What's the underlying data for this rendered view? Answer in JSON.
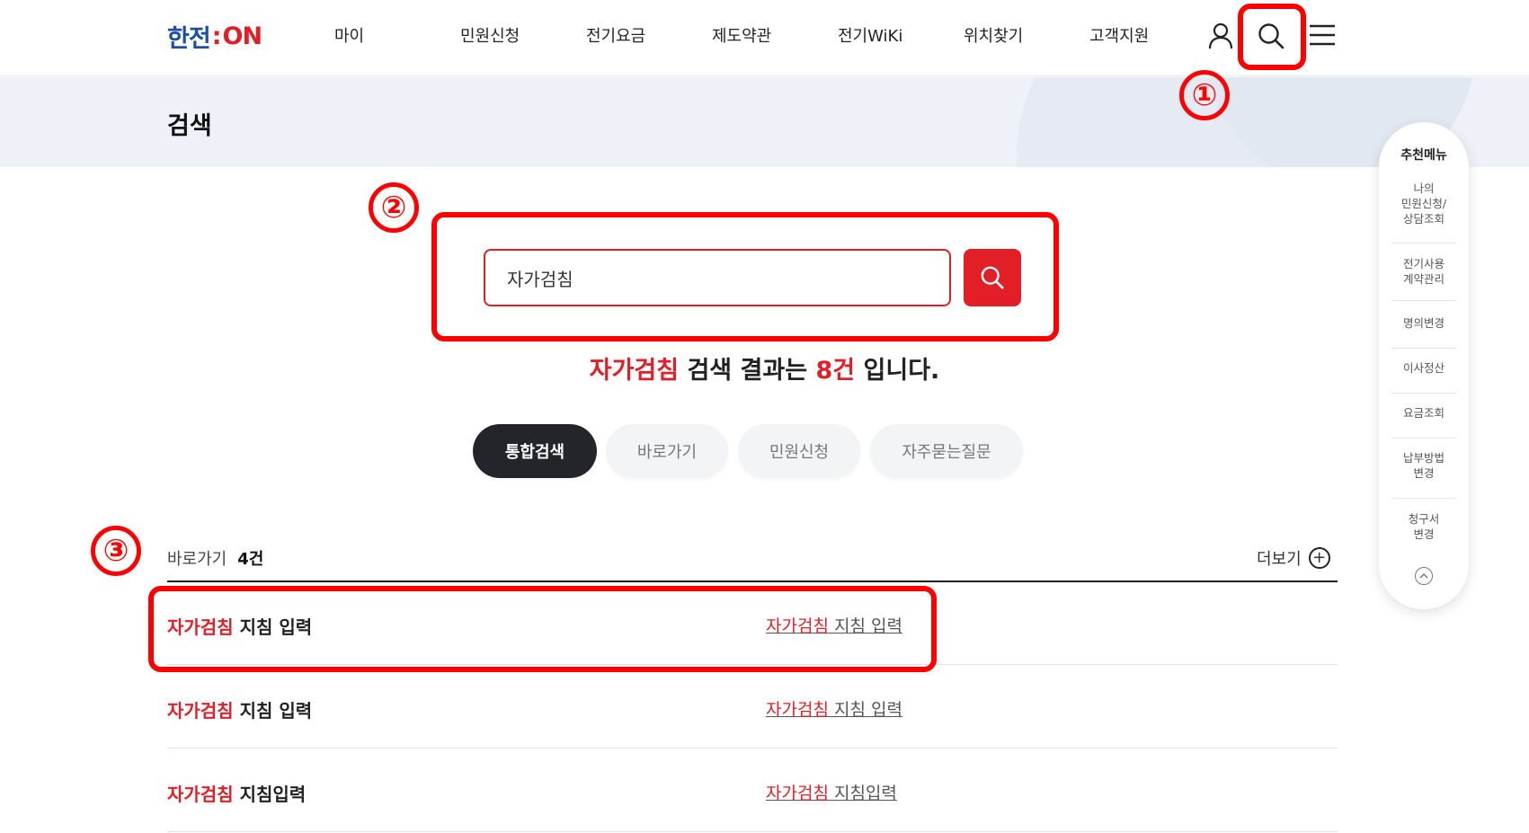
{
  "header": {
    "logo": {
      "left": "한전",
      "sep": ":",
      "right": "ON"
    },
    "nav": [
      "마이",
      "민원신청",
      "전기요금",
      "제도약관",
      "전기WiKi",
      "위치찾기",
      "고객지원"
    ],
    "icons": [
      "user-icon",
      "search-icon",
      "menu-icon"
    ]
  },
  "page": {
    "title": "검색"
  },
  "search": {
    "value": "자가검침",
    "placeholder": "",
    "summary_keyword": "자가검침",
    "summary_mid": " 검색 결과는 ",
    "summary_count": "8건",
    "summary_end": " 입니다."
  },
  "tabs": [
    {
      "label": "통합검색",
      "active": true
    },
    {
      "label": "바로가기",
      "active": false
    },
    {
      "label": "민원신청",
      "active": false
    },
    {
      "label": "자주묻는질문",
      "active": false
    }
  ],
  "section": {
    "label": "바로가기",
    "count": "4건",
    "more": "더보기",
    "rows": [
      {
        "title_hl": "자가검침",
        "title_rest": " 지침 입력",
        "link_hl": "자가검침",
        "link_rest": " 지침 입력"
      },
      {
        "title_hl": "자가검침",
        "title_rest": " 지침 입력",
        "link_hl": "자가검침",
        "link_rest": " 지침 입력"
      },
      {
        "title_hl": "자가검침",
        "title_rest": " 지침입력",
        "link_hl": "자가검침",
        "link_rest": " 지침입력"
      }
    ]
  },
  "sidebar": {
    "title": "추천메뉴",
    "items": [
      "나의\n민원신청/\n상담조회",
      "전기사용\n계약관리",
      "명의변경",
      "이사정산",
      "요금조회",
      "납부방법\n변경",
      "청구서\n변경"
    ]
  },
  "annotations": [
    "①",
    "②",
    "③"
  ],
  "colors": {
    "accent": "#e21e26",
    "brand_blue": "#1d4ea3",
    "annotation": "#ff0000",
    "dark_tab": "#23252b"
  }
}
